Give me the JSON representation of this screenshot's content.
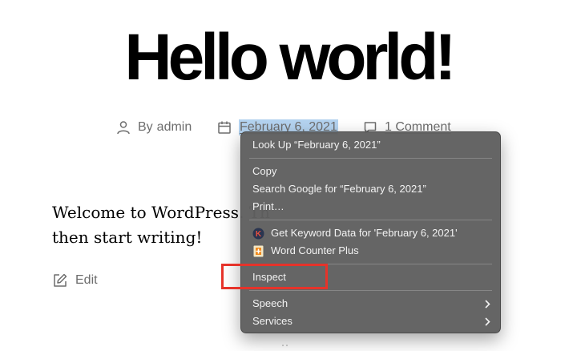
{
  "post": {
    "title": "Hello world!",
    "author_prefix": "By",
    "author": "admin",
    "date": "February 6, 2021",
    "comments": "1 Comment",
    "content_line1": "Welcome to WordPress. Th",
    "content_line2": "then start writing!",
    "edit_label": "Edit"
  },
  "context_menu": {
    "items": [
      {
        "label": "Look Up “February 6, 2021”"
      },
      {
        "label": "Copy"
      },
      {
        "label": "Search Google for “February 6, 2021”"
      },
      {
        "label": "Print…"
      },
      {
        "label": "Get Keyword Data for 'February 6, 2021'",
        "icon": "keywords-everywhere-icon"
      },
      {
        "label": "Word Counter Plus",
        "icon": "word-counter-icon"
      },
      {
        "label": "Inspect"
      },
      {
        "label": "Speech",
        "submenu": true
      },
      {
        "label": "Services",
        "submenu": true
      }
    ]
  },
  "colors": {
    "selection": "#b4d3f0",
    "menu_bg": "#606060",
    "highlight": "#e6332a",
    "meta_text": "#6d6d6d"
  }
}
